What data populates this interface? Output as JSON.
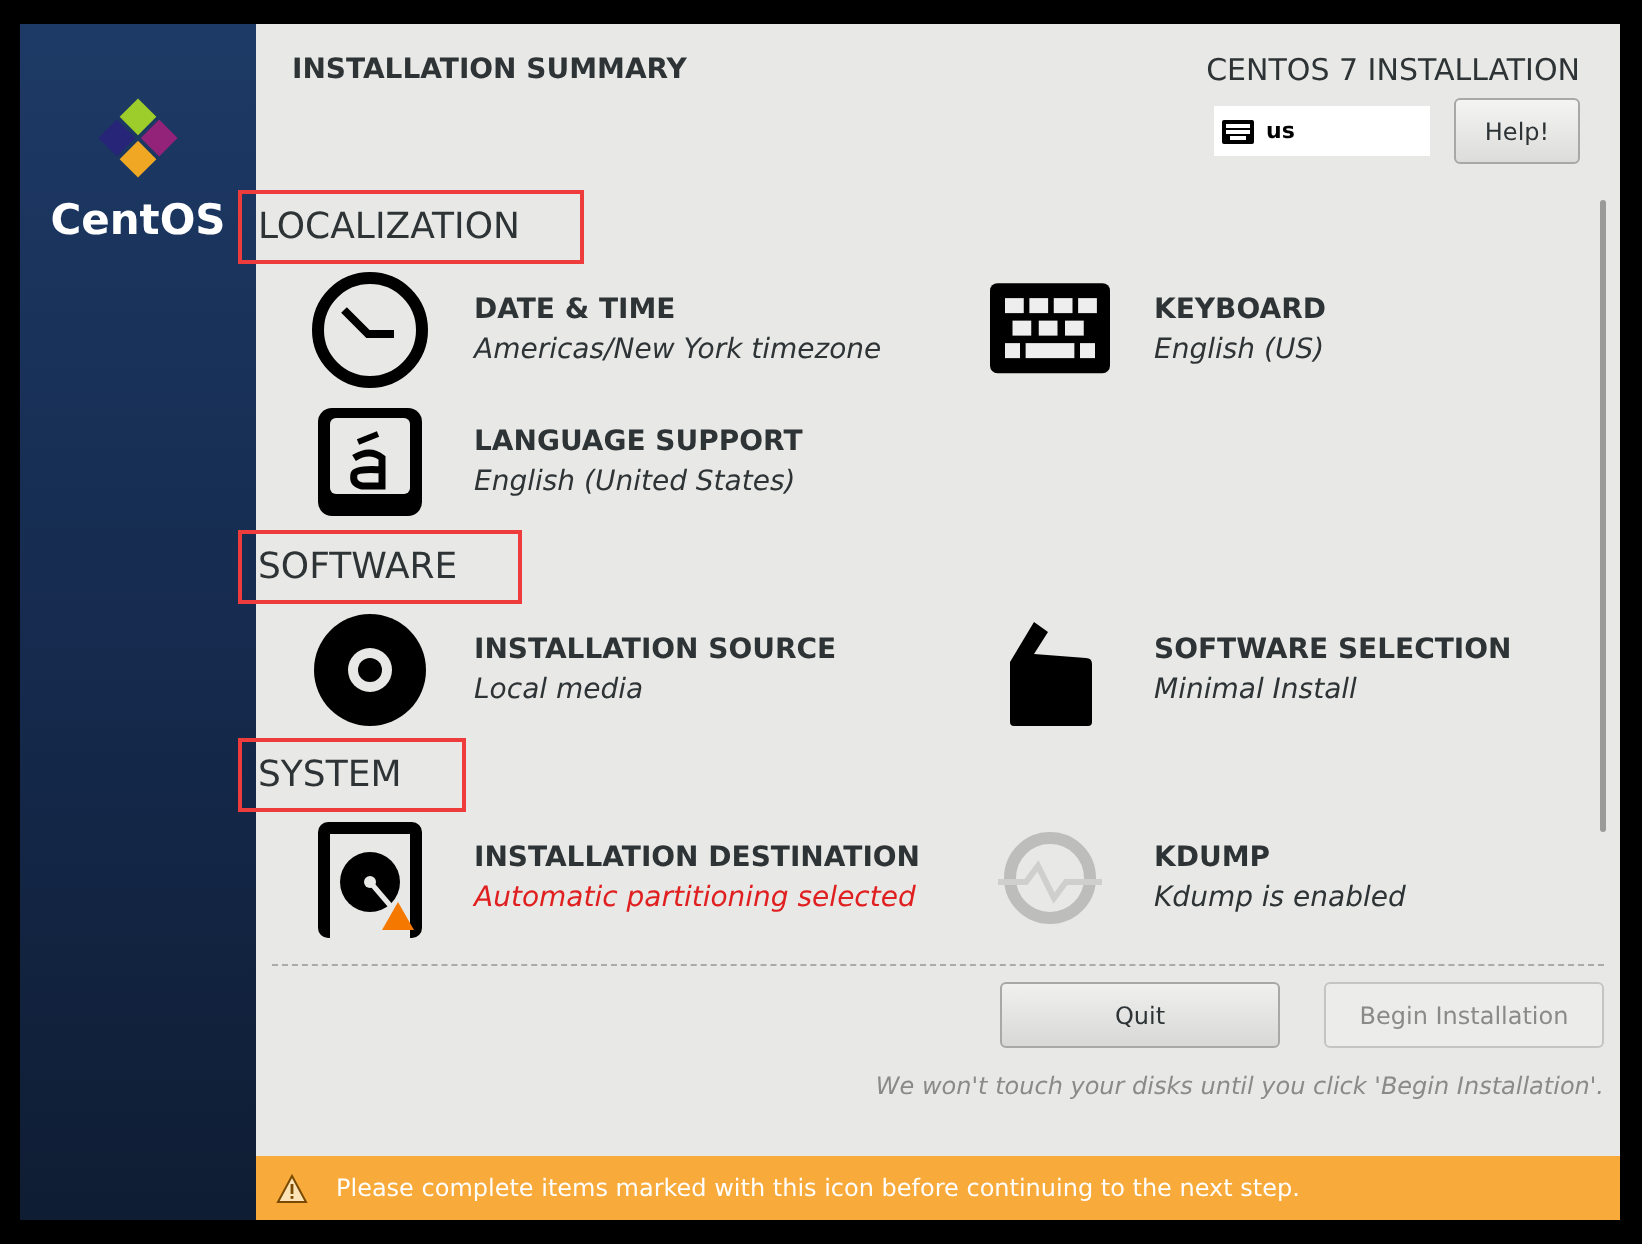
{
  "sidebar": {
    "logo_text": "CentOS"
  },
  "header": {
    "title": "INSTALLATION SUMMARY",
    "product": "CENTOS 7 INSTALLATION",
    "keyboard_layout": "us",
    "help_button": "Help!"
  },
  "sections": [
    {
      "heading": "LOCALIZATION",
      "highlighted": true,
      "items": [
        {
          "kind": "clock",
          "title": "DATE & TIME",
          "status": "Americas/New York timezone",
          "warning": false
        },
        {
          "kind": "keyboard",
          "title": "KEYBOARD",
          "status": "English (US)",
          "warning": false
        },
        {
          "kind": "language",
          "title": "LANGUAGE SUPPORT",
          "status": "English (United States)",
          "warning": false
        }
      ]
    },
    {
      "heading": "SOFTWARE",
      "highlighted": true,
      "items": [
        {
          "kind": "disc",
          "title": "INSTALLATION SOURCE",
          "status": "Local media",
          "warning": false
        },
        {
          "kind": "package",
          "title": "SOFTWARE SELECTION",
          "status": "Minimal Install",
          "warning": false
        }
      ]
    },
    {
      "heading": "SYSTEM",
      "highlighted": true,
      "items": [
        {
          "kind": "disk",
          "title": "INSTALLATION DESTINATION",
          "status": "Automatic partitioning selected",
          "warning": true
        },
        {
          "kind": "kdump",
          "title": "KDUMP",
          "status": "Kdump is enabled",
          "warning": false
        }
      ]
    }
  ],
  "buttons": [
    {
      "label": "Quit",
      "disabled": false
    },
    {
      "label": "Begin Installation",
      "disabled": true
    }
  ],
  "note": "We won't touch your disks until you click 'Begin Installation'.",
  "warning_bar": {
    "message": "Please complete items marked with this icon before continuing to the next step."
  }
}
